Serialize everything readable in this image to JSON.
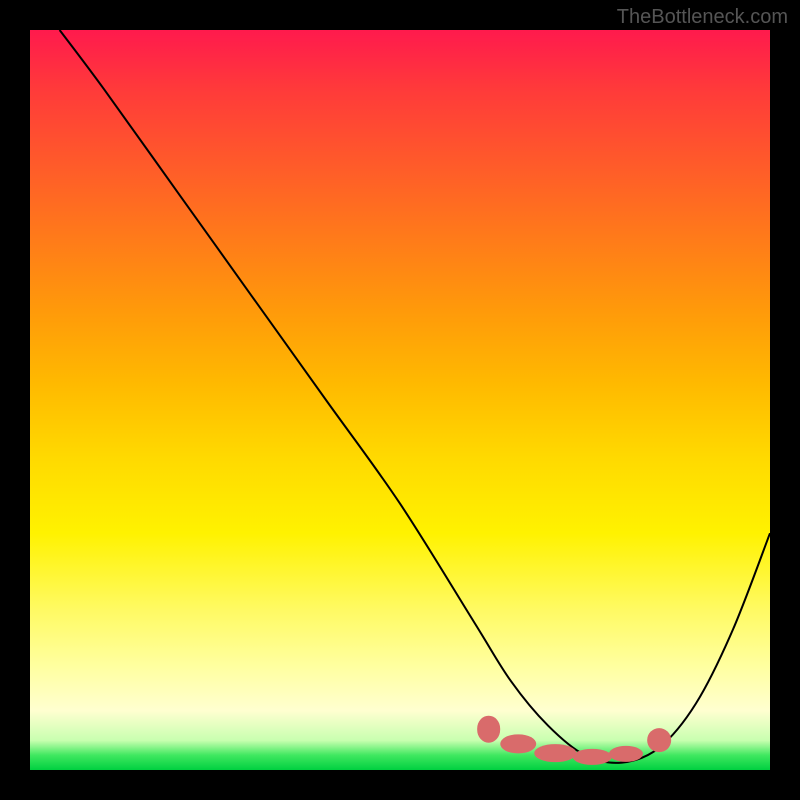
{
  "watermark": "TheBottleneck.com",
  "chart_data": {
    "type": "line",
    "title": "",
    "xlabel": "",
    "ylabel": "",
    "xlim": [
      0,
      100
    ],
    "ylim": [
      0,
      100
    ],
    "grid": false,
    "background": "gradient-red-yellow-green",
    "series": [
      {
        "name": "curve",
        "x": [
          4,
          10,
          20,
          30,
          40,
          50,
          60,
          65,
          70,
          75,
          80,
          85,
          90,
          95,
          100
        ],
        "y": [
          100,
          92,
          78,
          64,
          50,
          36,
          20,
          12,
          6,
          2,
          1,
          3,
          9,
          19,
          32
        ]
      }
    ],
    "markers": [
      {
        "x": 62,
        "y": 5.5,
        "rx": 1.6,
        "ry": 1.8
      },
      {
        "x": 66,
        "y": 3.5,
        "rx": 2.4,
        "ry": 1.3
      },
      {
        "x": 71,
        "y": 2.3,
        "rx": 2.8,
        "ry": 1.2
      },
      {
        "x": 76,
        "y": 1.8,
        "rx": 2.6,
        "ry": 1.1
      },
      {
        "x": 80.5,
        "y": 2.2,
        "rx": 2.3,
        "ry": 1.1
      },
      {
        "x": 85,
        "y": 4.0,
        "rx": 1.6,
        "ry": 1.6
      }
    ]
  }
}
